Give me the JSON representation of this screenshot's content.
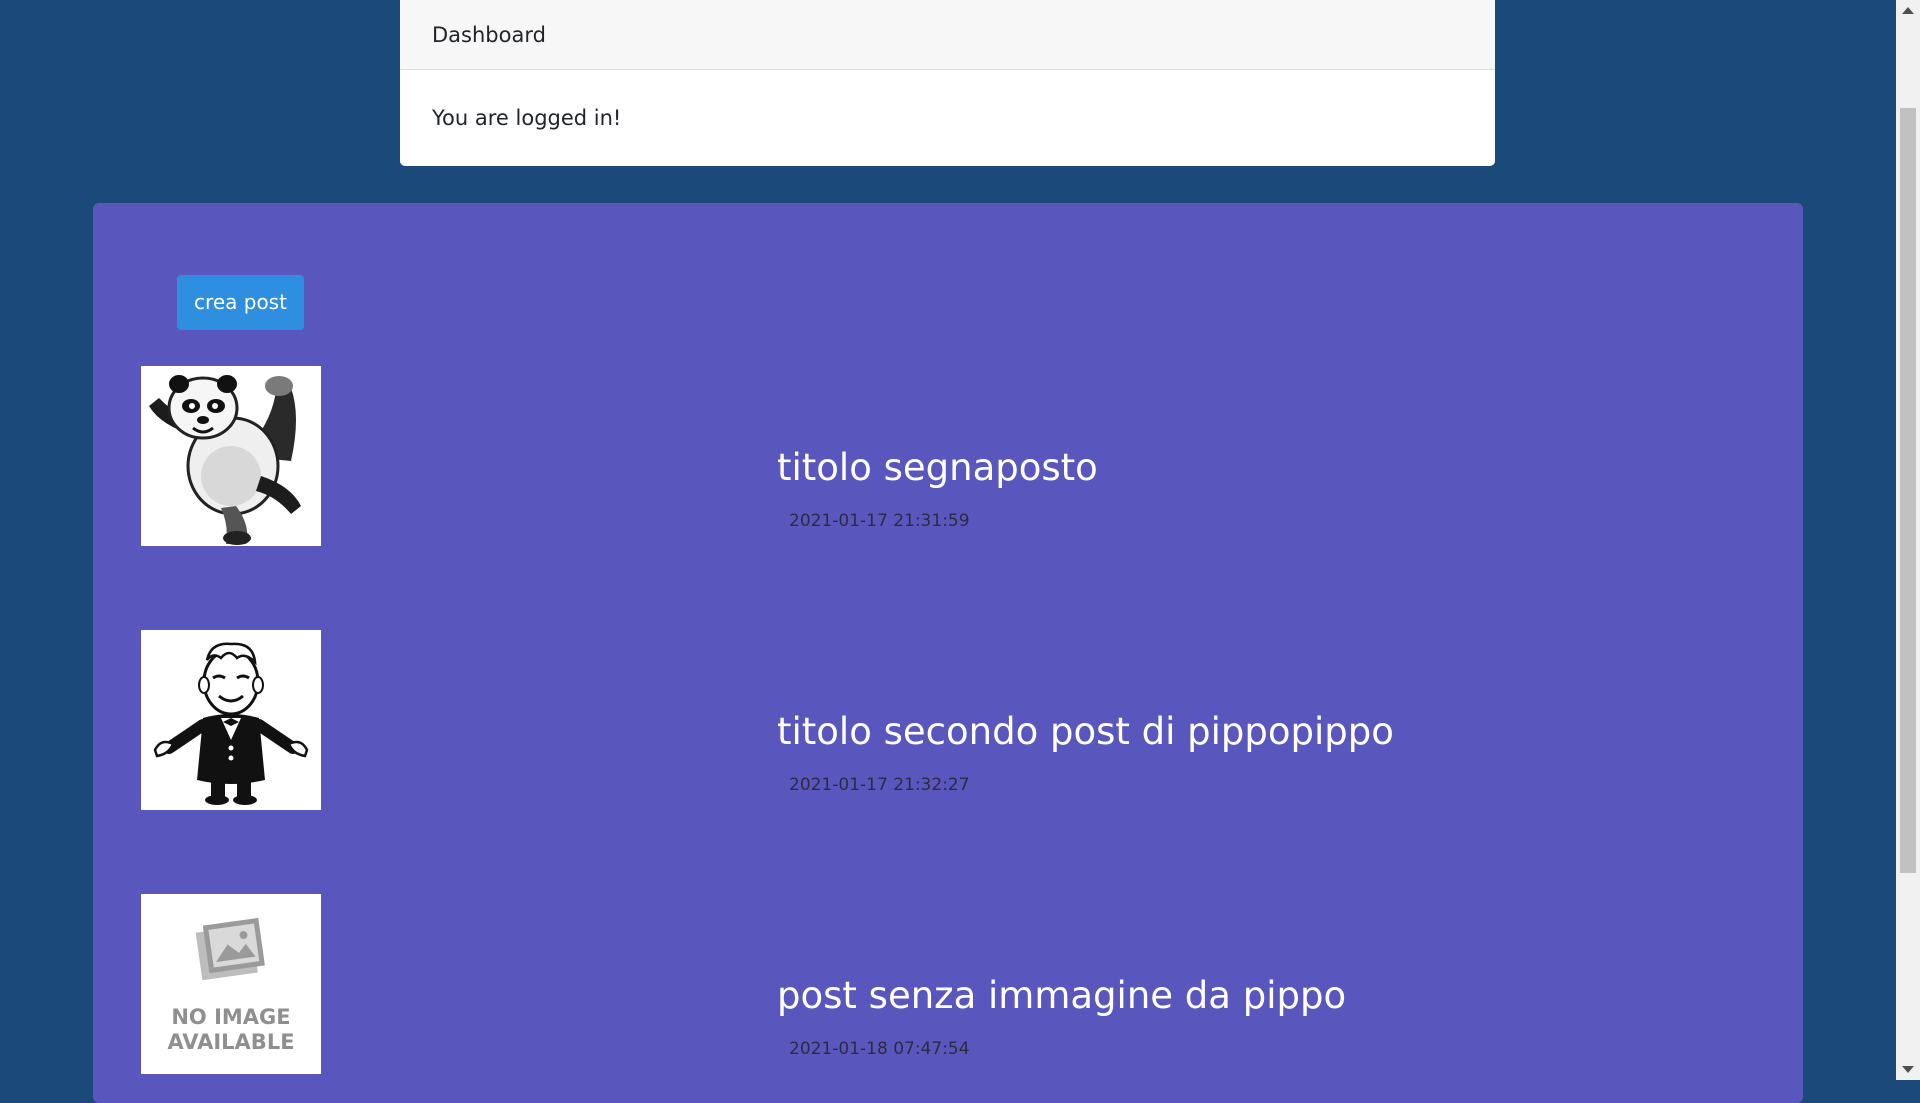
{
  "dashboard": {
    "header": "Dashboard",
    "message": "You are logged in!"
  },
  "actions": {
    "create_post_label": "crea post"
  },
  "posts": [
    {
      "title": "titolo segnaposto",
      "date": "2021-01-17 21:31:59",
      "image": "panda-image"
    },
    {
      "title": "titolo secondo post di pippopippo",
      "date": "2021-01-17 21:32:27",
      "image": "cartoon-man-image"
    },
    {
      "title": "post senza immagine da pippo",
      "date": "2021-01-18 07:47:54",
      "image": "no-image-placeholder",
      "image_text": [
        "NO IMAGE",
        "AVAILABLE"
      ]
    }
  ],
  "colors": {
    "background": "#1b4a7a",
    "panel": "#5957bd",
    "button": "#2e8ee0"
  }
}
